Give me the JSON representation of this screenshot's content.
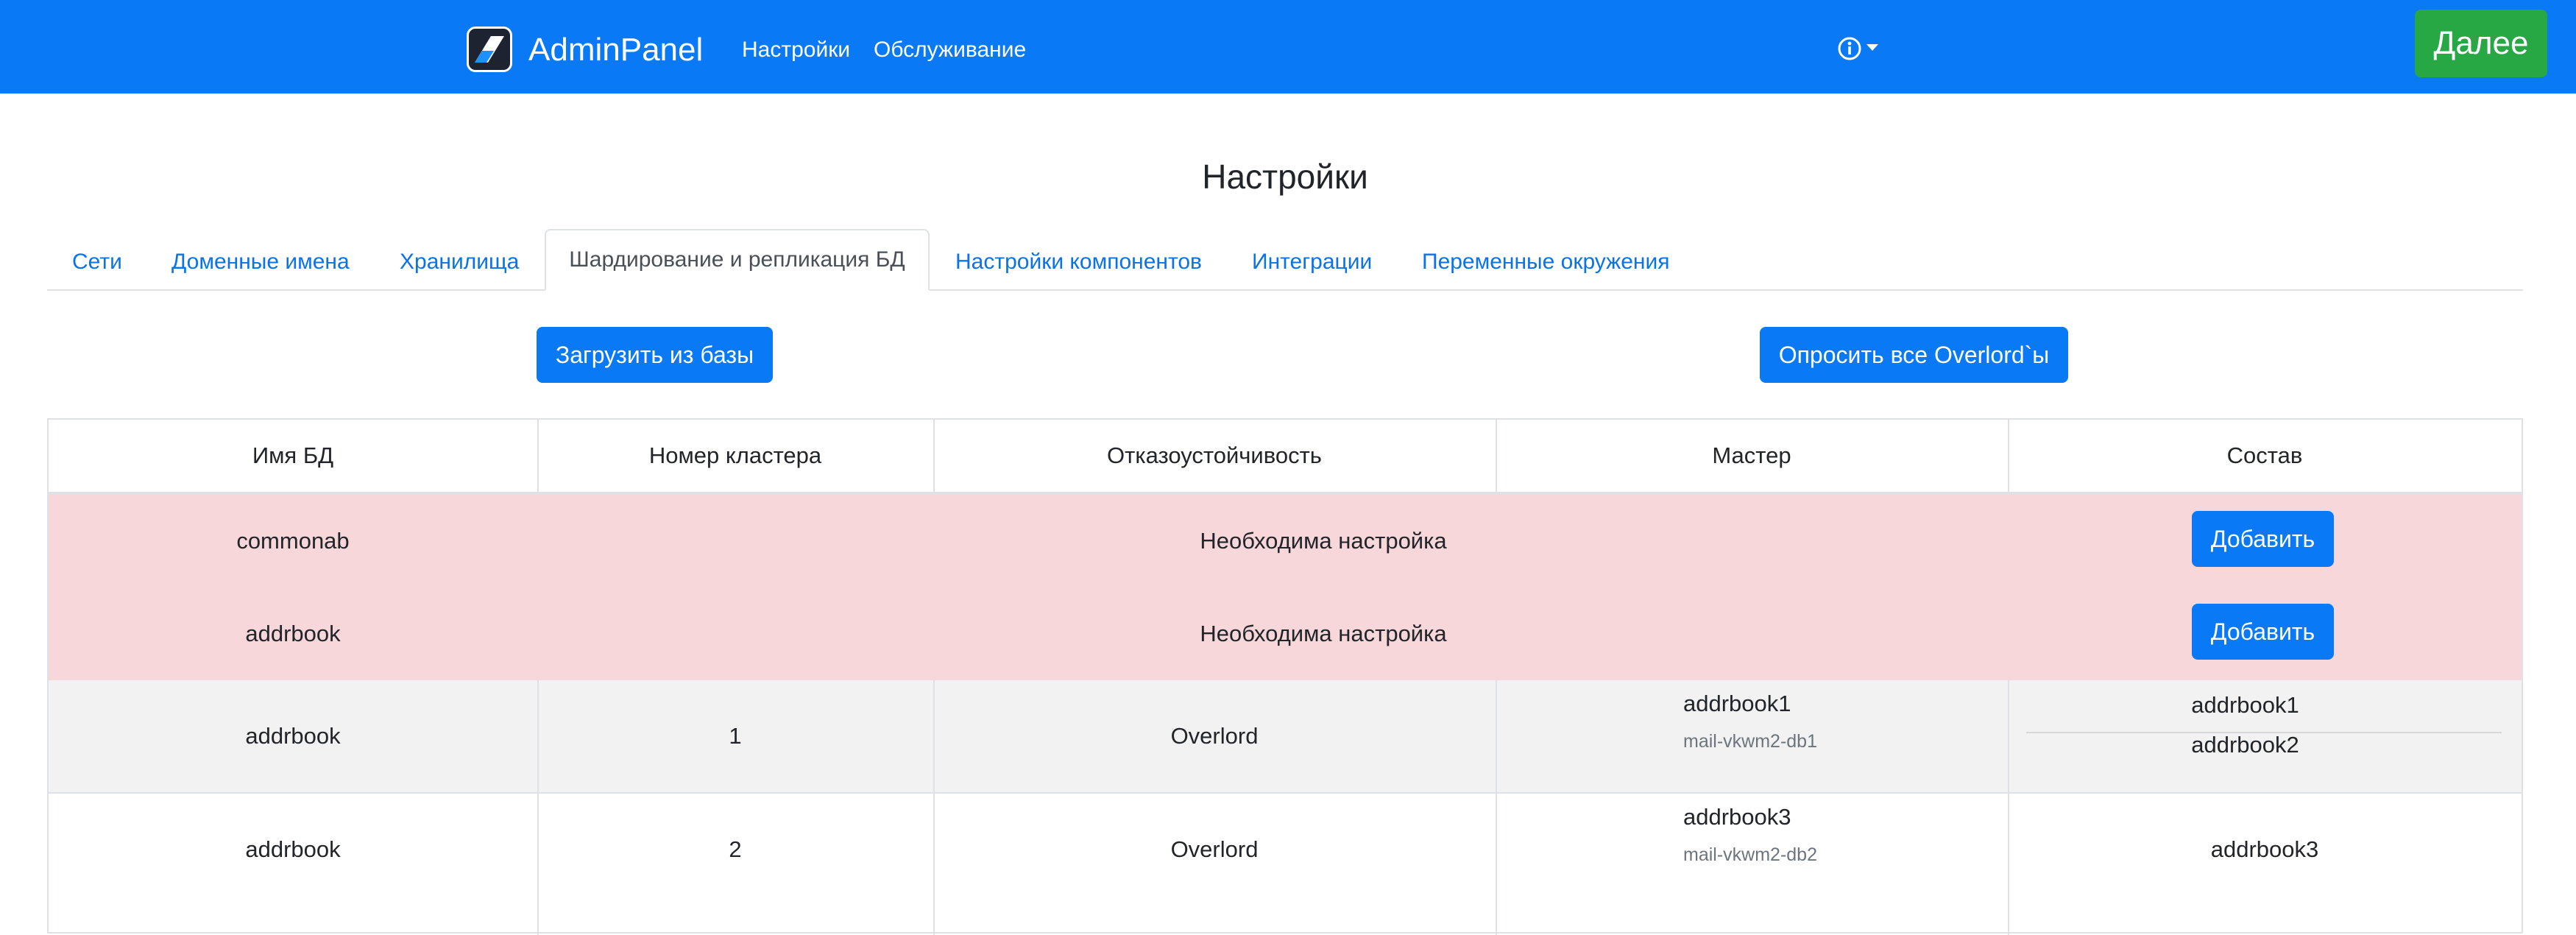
{
  "app": {
    "brand": "AdminPanel",
    "nav": [
      "Настройки",
      "Обслуживание"
    ],
    "next_label": "Далее",
    "colors": {
      "navbar": "#0a79f6",
      "next": "#28a745",
      "danger_row": "#f7d7da",
      "muted_row": "#f2f2f2"
    }
  },
  "page": {
    "title": "Настройки",
    "tabs": [
      "Сети",
      "Доменные имена",
      "Хранилища",
      "Шардирование и репликация БД",
      "Настройки компонентов",
      "Интеграции",
      "Переменные окружения"
    ],
    "active_tab": "Шардирование и репликация БД",
    "actions": {
      "load": "Загрузить из базы",
      "poll": "Опросить все Overlord`ы"
    }
  },
  "table": {
    "headers": [
      "Имя БД",
      "Номер кластера",
      "Отказоустойчивость",
      "Мастер",
      "Состав"
    ],
    "alert_rows": [
      {
        "db": "commonab",
        "status": "Необходима настройка",
        "action": "Добавить"
      },
      {
        "db": "addrbook",
        "status": "Необходима настройка",
        "action": "Добавить"
      }
    ],
    "rows": [
      {
        "db": "addrbook",
        "cluster": "1",
        "fault_tolerance": "Overlord",
        "master": "addrbook1",
        "master_host": "mail-vkwm2-db1",
        "members": [
          "addrbook1",
          "addrbook2"
        ]
      },
      {
        "db": "addrbook",
        "cluster": "2",
        "fault_tolerance": "Overlord",
        "master": "addrbook3",
        "master_host": "mail-vkwm2-db2",
        "members": [
          "addrbook3"
        ]
      }
    ]
  }
}
